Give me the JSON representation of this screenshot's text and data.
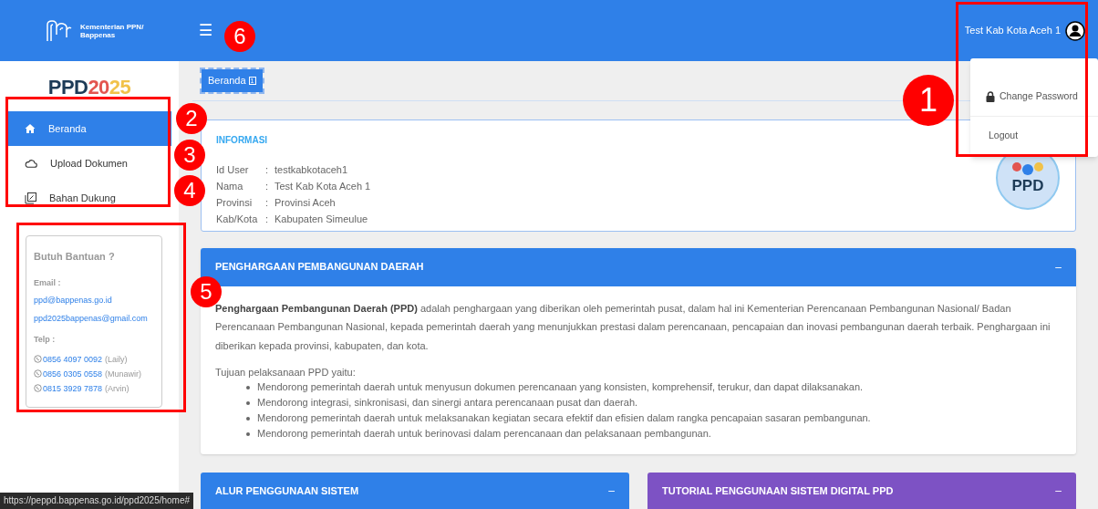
{
  "header": {
    "org_name": "Kementerian PPN/ Bappenas",
    "menu_icon": "☰",
    "user_name": "Test Kab Kota Aceh 1"
  },
  "user_menu": {
    "items": [
      {
        "kind": "lock",
        "label": "Change Password"
      },
      {
        "kind": "plain",
        "label": "Logout"
      }
    ]
  },
  "sidebar": {
    "logo": {
      "dark": "PPD",
      "red": "20",
      "yellow": "25"
    },
    "items": [
      {
        "kind": "home",
        "label": "Beranda",
        "selected": true
      },
      {
        "kind": "cloud",
        "label": "Upload Dokumen",
        "selected": false
      },
      {
        "kind": "docs",
        "label": "Bahan Dukung",
        "selected": false
      }
    ],
    "help": {
      "title": "Butuh Bantuan ?",
      "email_label": "Email :",
      "emails": [
        "ppd@bappenas.go.id",
        "ppd2025bappenas@gmail.com"
      ],
      "phone_label": "Telp :",
      "phones": [
        {
          "number": "0856 4097 0092",
          "name": "(Laily)"
        },
        {
          "number": "0856 0305 0558",
          "name": "(Munawir)"
        },
        {
          "number": "0815 3929 7878",
          "name": "(Arvin)"
        }
      ]
    }
  },
  "breadcrumb": {
    "label": "Beranda",
    "badge": "1"
  },
  "info": {
    "title": "INFORMASI",
    "rows": [
      {
        "key": "Id User",
        "separator": ":",
        "value": "testkabkotaceh1"
      },
      {
        "key": "Nama",
        "separator": ":",
        "value": "Test Kab Kota Aceh 1"
      },
      {
        "key": "Provinsi",
        "separator": ":",
        "value": "Provinsi Aceh"
      },
      {
        "key": "Kab/Kota",
        "separator": ":",
        "value": "Kabupaten Simeulue"
      }
    ],
    "logo_text": "PPD"
  },
  "award": {
    "title": "PENGHARGAAN PEMBANGUNAN DAERAH",
    "collapse": "–",
    "paragraph": "**Penghargaan Pembangunan Daerah (PPD)** adalah penghargaan yang diberikan oleh pemerintah pusat, dalam hal ini Kementerian Perencanaan Pembangunan Nasional/ Badan Perencanaan Pembangunan Nasional, kepada pemerintah daerah yang menunjukkan prestasi dalam perencanaan, pencapaian dan inovasi pembangunan daerah terbaik. Penghargaan ini diberikan kepada provinsi, kabupaten, dan kota.",
    "goals_intro": "Tujuan pelaksanaan PPD yaitu:",
    "goals": [
      "Mendorong pemerintah daerah untuk menyusun dokumen perencanaan yang konsisten, komprehensif, terukur, dan dapat dilaksanakan.",
      "Mendorong integrasi, sinkronisasi, dan sinergi antara perencanaan pusat dan daerah.",
      "Mendorong pemerintah daerah untuk melaksanakan kegiatan secara efektif dan efisien dalam rangka pencapaian sasaran pembangunan.",
      "Mendorong pemerintah daerah untuk berinovasi dalam perencanaan dan pelaksanaan pembangunan."
    ]
  },
  "bottom_panels": [
    {
      "title": "ALUR PENGGUNAAN SISTEM",
      "collapse": "–",
      "color": "#2f80e8"
    },
    {
      "title": "TUTORIAL PENGGUNAAN SISTEM DIGITAL PPD",
      "collapse": "–",
      "color": "#7d52c4"
    }
  ],
  "status_url": "https://peppd.bappenas.go.id/ppd2025/home#",
  "annotations": [
    "1",
    "2",
    "3",
    "4",
    "5",
    "6"
  ]
}
